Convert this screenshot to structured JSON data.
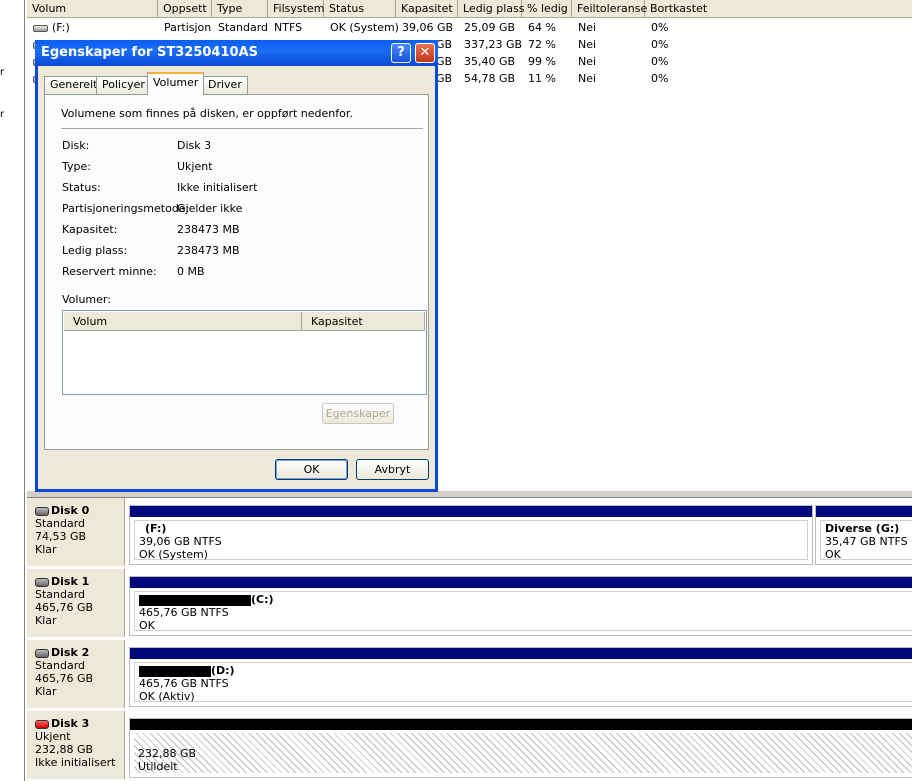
{
  "left_fragments": [
    "r",
    "r"
  ],
  "volume_list": {
    "headers": [
      "Volum",
      "Oppsett",
      "Type",
      "Filsystem",
      "Status",
      "Kapasitet",
      "Ledig plass",
      "% ledig",
      "Feiltoleranse",
      "Bortkastet"
    ],
    "rows": [
      {
        "volum": "(F:)",
        "oppsett": "Partisjon",
        "type": "Standard",
        "fs": "NTFS",
        "status": "OK (System)",
        "kapasitet": "39,06 GB",
        "ledig": "25,09 GB",
        "pct": "64 %",
        "feil": "Nei",
        "bort": "0%"
      },
      {
        "kapasitet": "GB",
        "ledig": "337,23 GB",
        "pct": "72 %",
        "feil": "Nei",
        "bort": "0%"
      },
      {
        "kapasitet": "GB",
        "ledig": "35,40 GB",
        "pct": "99 %",
        "feil": "Nei",
        "bort": "0%"
      },
      {
        "kapasitet": "GB",
        "ledig": "54,78 GB",
        "pct": "11 %",
        "feil": "Nei",
        "bort": "0%"
      }
    ]
  },
  "dialog": {
    "title": "Egenskaper for ST3250410AS",
    "help_glyph": "?",
    "close_glyph": "✕",
    "tabs": [
      "Generelt",
      "Policyer",
      "Volumer",
      "Driver"
    ],
    "active_tab": "Volumer",
    "description": "Volumene som finnes på disken, er oppført nedenfor.",
    "properties": [
      {
        "label": "Disk:",
        "value": "Disk 3"
      },
      {
        "label": "Type:",
        "value": "Ukjent"
      },
      {
        "label": "Status:",
        "value": "Ikke initialisert"
      },
      {
        "label": "Partisjoneringsmetode:",
        "value": "Gjelder ikke"
      },
      {
        "label": "Kapasitet:",
        "value": "238473 MB"
      },
      {
        "label": "Ledig plass:",
        "value": "238473 MB"
      },
      {
        "label": "Reservert minne:",
        "value": "0 MB"
      }
    ],
    "volumes_label": "Volumer:",
    "volumes_columns": [
      "Volum",
      "Kapasitet"
    ],
    "properties_button": "Egenskaper",
    "ok_button": "OK",
    "cancel_button": "Avbryt"
  },
  "disks": [
    {
      "name": "Disk 0",
      "type": "Standard",
      "size": "74,53 GB",
      "state": "Klar",
      "partitions": [
        {
          "name": "(F:)",
          "size": "39,06 GB NTFS",
          "status": "OK (System)"
        },
        {
          "name": "Diverse  (G:)",
          "size": "35,47 GB NTFS",
          "status": "OK"
        }
      ]
    },
    {
      "name": "Disk 1",
      "type": "Standard",
      "size": "465,76 GB",
      "state": "Klar",
      "partitions": [
        {
          "name": "(C:)",
          "size": "465,76 GB NTFS",
          "status": "OK"
        }
      ]
    },
    {
      "name": "Disk 2",
      "type": "Standard",
      "size": "465,76 GB",
      "state": "Klar",
      "partitions": [
        {
          "name": "(D:)",
          "size": "465,76 GB NTFS",
          "status": "OK (Aktiv)"
        }
      ]
    },
    {
      "name": "Disk 3",
      "type": "Ukjent",
      "size": "232,88 GB",
      "state": "Ikke initialisert",
      "partitions": [
        {
          "size": "232,88 GB",
          "status": "Utildelt"
        }
      ]
    }
  ],
  "colors": {
    "primary_partition_bar": "#00087b",
    "unallocated_bar": "#000000",
    "titlebar": "#0a49d6",
    "active_tab_accent": "#f5b035"
  }
}
